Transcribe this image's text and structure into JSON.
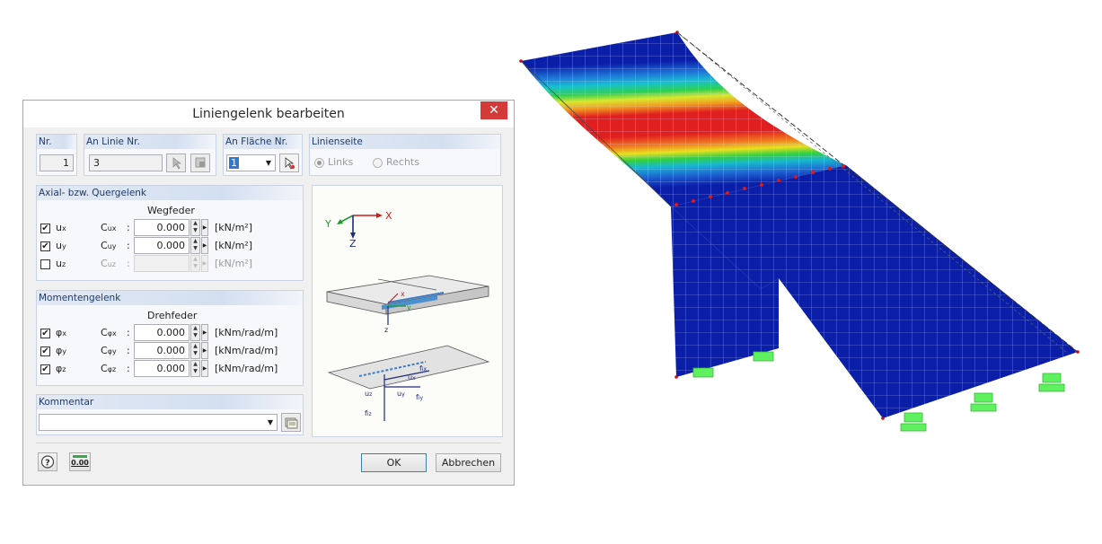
{
  "dialog": {
    "title": "Liniengelenk bearbeiten",
    "close_glyph": "✕"
  },
  "nr": {
    "header": "Nr.",
    "value": "1"
  },
  "an_linie": {
    "header": "An Linie Nr.",
    "value": "3"
  },
  "an_flaeche": {
    "header": "An Fläche Nr.",
    "value": "1"
  },
  "linienseite": {
    "header": "Linienseite",
    "options": [
      "Links",
      "Rechts"
    ],
    "selected": "Links"
  },
  "axial": {
    "header": "Axial- bzw. Quergelenk",
    "subheader": "Wegfeder",
    "rows": [
      {
        "check": "u",
        "check_sub": "x",
        "checked": true,
        "const": "C",
        "const_sub": "ux",
        "value": "0.000",
        "unit": "[kN/m²]",
        "enabled": true
      },
      {
        "check": "u",
        "check_sub": "y",
        "checked": true,
        "const": "C",
        "const_sub": "uy",
        "value": "0.000",
        "unit": "[kN/m²]",
        "enabled": true
      },
      {
        "check": "u",
        "check_sub": "z",
        "checked": false,
        "const": "C",
        "const_sub": "uz",
        "value": "",
        "unit": "[kN/m²]",
        "enabled": false
      }
    ]
  },
  "moment": {
    "header": "Momentengelenk",
    "subheader": "Drehfeder",
    "rows": [
      {
        "check": "φ",
        "check_sub": "x",
        "checked": true,
        "const": "C",
        "const_sub": "φx",
        "value": "0.000",
        "unit": "[kNm/rad/m]",
        "enabled": true
      },
      {
        "check": "φ",
        "check_sub": "y",
        "checked": true,
        "const": "C",
        "const_sub": "φy",
        "value": "0.000",
        "unit": "[kNm/rad/m]",
        "enabled": true
      },
      {
        "check": "φ",
        "check_sub": "z",
        "checked": true,
        "const": "C",
        "const_sub": "φz",
        "value": "0.000",
        "unit": "[kNm/rad/m]",
        "enabled": true
      }
    ]
  },
  "colon": ":",
  "kommentar": {
    "header": "Kommentar",
    "value": ""
  },
  "picture": {
    "axis_x": "X",
    "axis_y": "Y",
    "axis_z": "Z",
    "local_x": "x",
    "local_y": "y",
    "local_z": "z",
    "ux": "u",
    "ux_sub": "x",
    "uy": "u",
    "uy_sub": "y",
    "uz": "u",
    "uz_sub": "z",
    "fix": "f",
    "fix_sub": "ix",
    "fiy": "f",
    "fiy_sub": "iy",
    "fiz": "f",
    "fiz_sub": "iz"
  },
  "buttons": {
    "ok": "OK",
    "cancel": "Abbrechen",
    "units_label": "0.00"
  },
  "colors": {
    "close": "#d33b3b",
    "group_header": "#d3dff0",
    "mesh_blue": "#0a1ea8",
    "support_green": "#5ef05e"
  }
}
